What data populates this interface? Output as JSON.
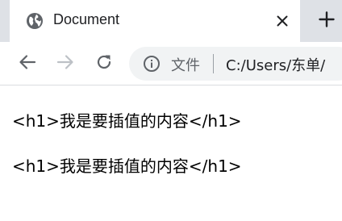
{
  "tab": {
    "title": "Document",
    "favicon": "globe-icon",
    "close_icon": "close-icon"
  },
  "new_tab_icon": "plus-icon",
  "toolbar": {
    "back_icon": "back-arrow-icon",
    "forward_icon": "forward-arrow-icon",
    "reload_icon": "reload-icon"
  },
  "omnibox": {
    "info_icon": "info-icon",
    "security_label": "文件",
    "url": "C:/Users/东单/"
  },
  "page": {
    "lines": [
      "<h1>我是要插值的内容</h1>",
      "<h1>我是要插值的内容</h1>"
    ]
  },
  "colors": {
    "tabstrip": "#dee1e6",
    "omnibox": "#f1f3f4",
    "icon": "#5f6368",
    "disabled_icon": "#bdc1c6"
  }
}
